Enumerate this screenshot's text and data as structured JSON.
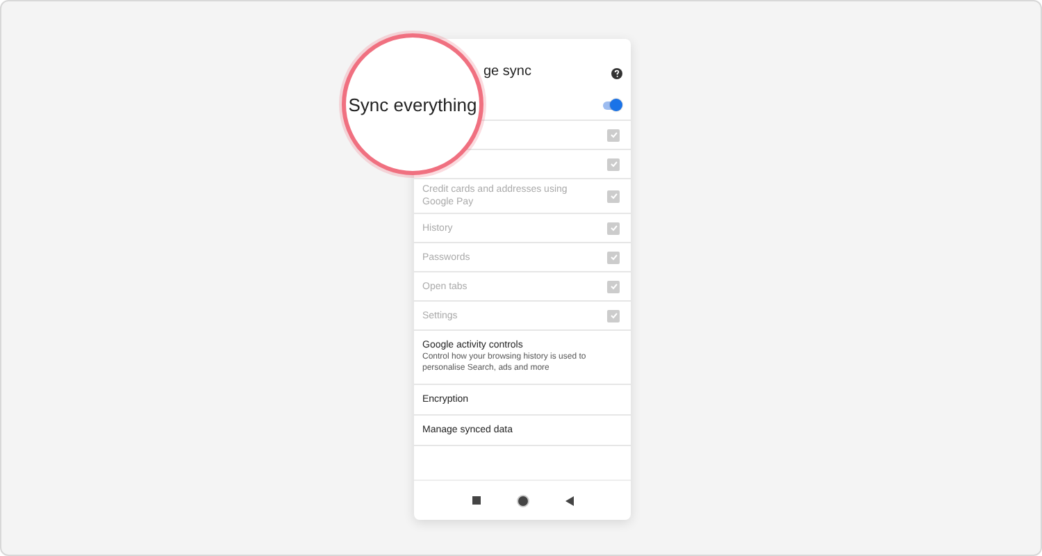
{
  "header": {
    "title": "ge sync"
  },
  "magnifier": {
    "text": "Sync everything"
  },
  "sync_everything": {
    "on": true
  },
  "sync_items": [
    {
      "checked": true,
      "disabled": true
    },
    {
      "checked": true,
      "disabled": true
    },
    {
      "label": "Credit cards and addresses using Google Pay",
      "checked": true,
      "disabled": true
    },
    {
      "label": "History",
      "checked": true,
      "disabled": true
    },
    {
      "label": "Passwords",
      "checked": true,
      "disabled": true
    },
    {
      "label": "Open tabs",
      "checked": true,
      "disabled": true
    },
    {
      "label": "Settings",
      "checked": true,
      "disabled": true
    }
  ],
  "links": [
    {
      "title": "Google activity controls",
      "subtitle": "Control how your browsing history is used to personalise Search, ads and more"
    },
    {
      "title": "Encryption"
    },
    {
      "title": "Manage synced data"
    }
  ]
}
